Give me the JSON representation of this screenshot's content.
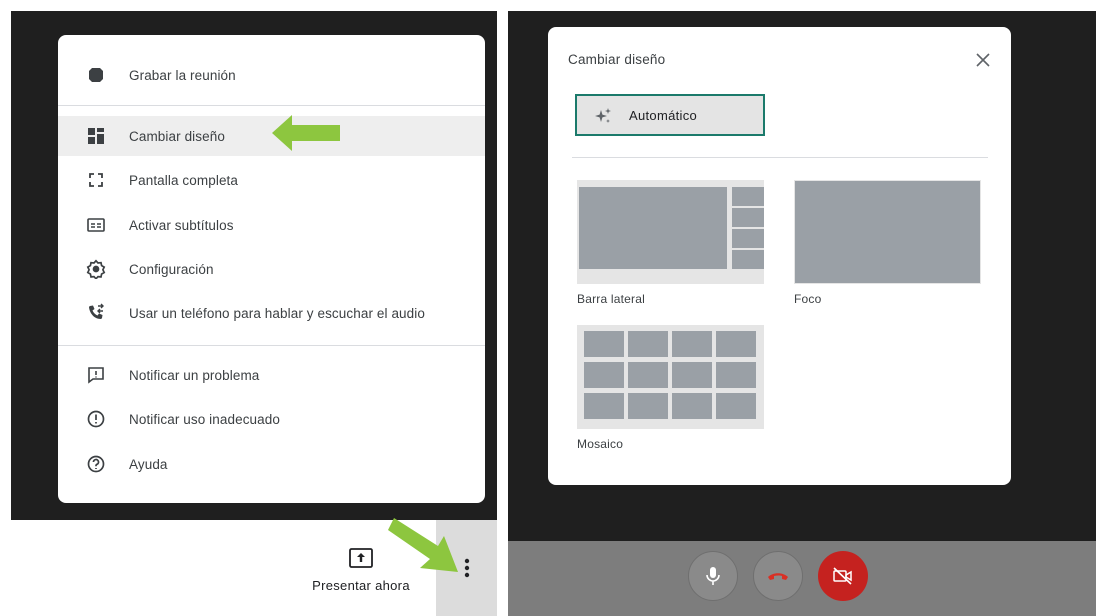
{
  "left": {
    "menu": {
      "items": [
        {
          "label": "Grabar la reunión",
          "icon": "record-icon"
        },
        {
          "label": "Cambiar diseño",
          "icon": "layout-icon",
          "active": true
        },
        {
          "label": "Pantalla completa",
          "icon": "fullscreen-icon"
        },
        {
          "label": "Activar subtítulos",
          "icon": "captions-icon"
        },
        {
          "label": "Configuración",
          "icon": "settings-gear-icon"
        },
        {
          "label": "Usar un teléfono para hablar y escuchar el audio",
          "icon": "phone-audio-icon"
        },
        {
          "label": "Notificar un problema",
          "icon": "report-problem-icon"
        },
        {
          "label": "Notificar uso inadecuado",
          "icon": "report-abuse-icon"
        },
        {
          "label": "Ayuda",
          "icon": "help-icon"
        }
      ]
    },
    "bottom_bar": {
      "present_label": "Presentar ahora",
      "present_icon": "present-screen-icon",
      "more_icon": "more-vert-icon"
    }
  },
  "right": {
    "dialog": {
      "title": "Cambiar diseño",
      "close_icon": "close-icon",
      "auto_label": "Automático",
      "auto_icon": "sparkle-icon",
      "options": [
        {
          "label": "Barra lateral"
        },
        {
          "label": "Foco"
        },
        {
          "label": "Mosaico"
        }
      ]
    },
    "controls": {
      "mic_icon": "microphone-icon",
      "hangup_icon": "hang-up-icon",
      "camera_icon": "camera-off-icon"
    }
  },
  "colors": {
    "arrow": "#8dc63f",
    "accent_border": "#1b7a6b",
    "camera_off": "#c5221f",
    "hangup": "#d93025",
    "tile": "#9aa0a6"
  }
}
